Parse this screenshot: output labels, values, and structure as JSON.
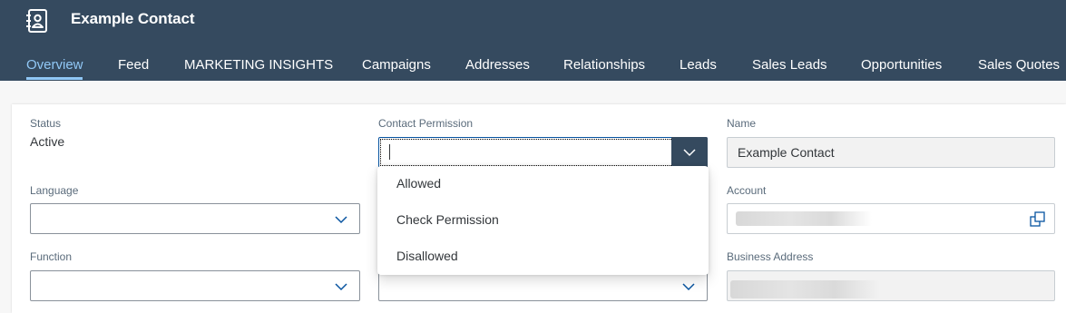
{
  "header": {
    "app_icon": "contact-book-icon",
    "title": "Example Contact",
    "background": "#354a5f"
  },
  "tabs": [
    {
      "label": "Overview",
      "active": true
    },
    {
      "label": "Feed"
    },
    {
      "label": "MARKETING INSIGHTS"
    },
    {
      "label": "Campaigns"
    },
    {
      "label": "Addresses"
    },
    {
      "label": "Relationships"
    },
    {
      "label": "Leads"
    },
    {
      "label": "Sales Leads"
    },
    {
      "label": "Opportunities"
    },
    {
      "label": "Sales Quotes"
    }
  ],
  "form": {
    "status": {
      "label": "Status",
      "value": "Active"
    },
    "contact_permission": {
      "label": "Contact Permission",
      "value": ""
    },
    "name": {
      "label": "Name",
      "value": "Example Contact"
    },
    "language": {
      "label": "Language",
      "value": ""
    },
    "account": {
      "label": "Account",
      "value_redacted": true
    },
    "function": {
      "label": "Function",
      "value": ""
    },
    "business_address": {
      "label": "Business Address",
      "value_redacted": true
    }
  },
  "dropdown": {
    "options": [
      "Allowed",
      "Check Permission",
      "Disallowed"
    ]
  },
  "colors": {
    "accent": "#91c8f6",
    "button": "#354a5f",
    "focus": "#0854a0"
  }
}
